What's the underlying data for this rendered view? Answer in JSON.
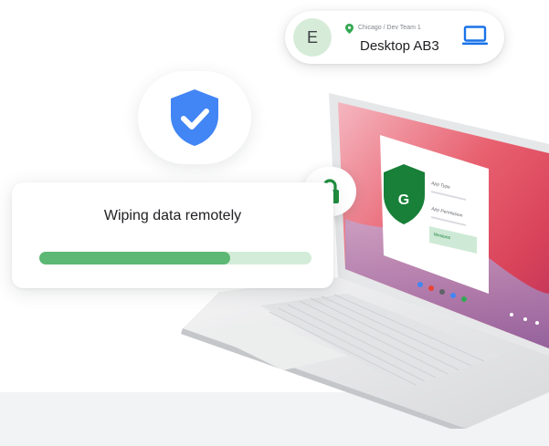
{
  "device_card": {
    "avatar_letter": "E",
    "location": "Chicago / Dev Team 1",
    "device_name": "Desktop AB3",
    "icon": "laptop-icon",
    "pin_icon": "location-pin-icon"
  },
  "wipe_card": {
    "title": "Wiping data remotely",
    "progress": 0.7
  },
  "laptop_screen": {
    "app_shield_letter": "G",
    "labels": [
      "App Type",
      "App Permission",
      "Versions"
    ]
  },
  "colors": {
    "shield_blue": "#4285f4",
    "accent_green": "#34a853",
    "progress_fill": "#5cb874",
    "progress_track": "#d3ecd9",
    "floor": "#f1f3f5"
  }
}
